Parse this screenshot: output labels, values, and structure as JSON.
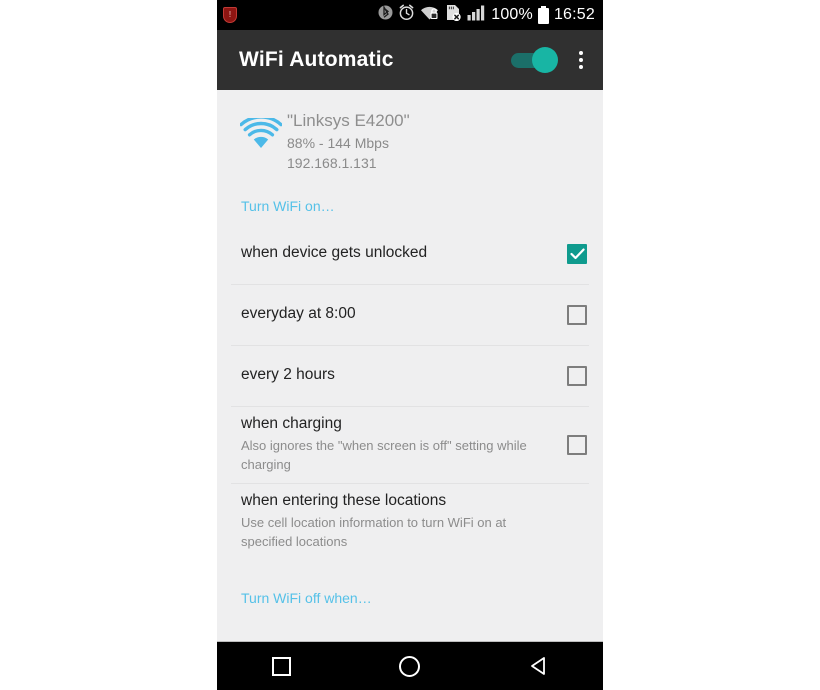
{
  "statusbar": {
    "notification_icon": "shield-notification-icon",
    "icons": [
      "bluetooth-icon",
      "alarm-clock-icon",
      "wifi-secure-icon",
      "sd-card-removed-icon",
      "signal-bars-icon"
    ],
    "battery_percent": "100%",
    "battery_icon": "battery-full-icon",
    "time": "16:52"
  },
  "appbar": {
    "title": "WiFi Automatic",
    "toggle": {
      "name": "master-toggle",
      "state": "on",
      "track_color": "#1b6f69",
      "thumb_color": "#18b5a4"
    },
    "overflow_label": "More options"
  },
  "wifi_status": {
    "icon": "wifi-signal-icon",
    "icon_color": "#4cb9e8",
    "ssid": "\"Linksys E4200\"",
    "speed": "88% - 144 Mbps",
    "ip_address": "192.168.1.131"
  },
  "sections": {
    "turn_on_header": "Turn WiFi on…",
    "turn_off_header": "Turn WiFi off when…"
  },
  "rows": [
    {
      "title": "when device gets unlocked",
      "subtitle": "",
      "checked": true,
      "has_checkbox": true
    },
    {
      "title": "everyday at 8:00",
      "subtitle": "",
      "checked": false,
      "has_checkbox": true
    },
    {
      "title": "every 2 hours",
      "subtitle": "",
      "checked": false,
      "has_checkbox": true
    },
    {
      "title": "when charging",
      "subtitle": "Also ignores the \"when screen is off\" setting while charging",
      "checked": false,
      "has_checkbox": true
    },
    {
      "title": "when entering these locations",
      "subtitle": "Use cell location information to turn WiFi on at specified locations",
      "checked": false,
      "has_checkbox": false
    }
  ],
  "navbar": {
    "recents": "recents-square-icon",
    "home": "home-circle-icon",
    "back": "back-triangle-icon"
  },
  "colors": {
    "accent_teal": "#0f9b8e",
    "section_blue": "#55c1e8",
    "appbar_bg": "#303030",
    "content_bg": "#efeff0"
  }
}
